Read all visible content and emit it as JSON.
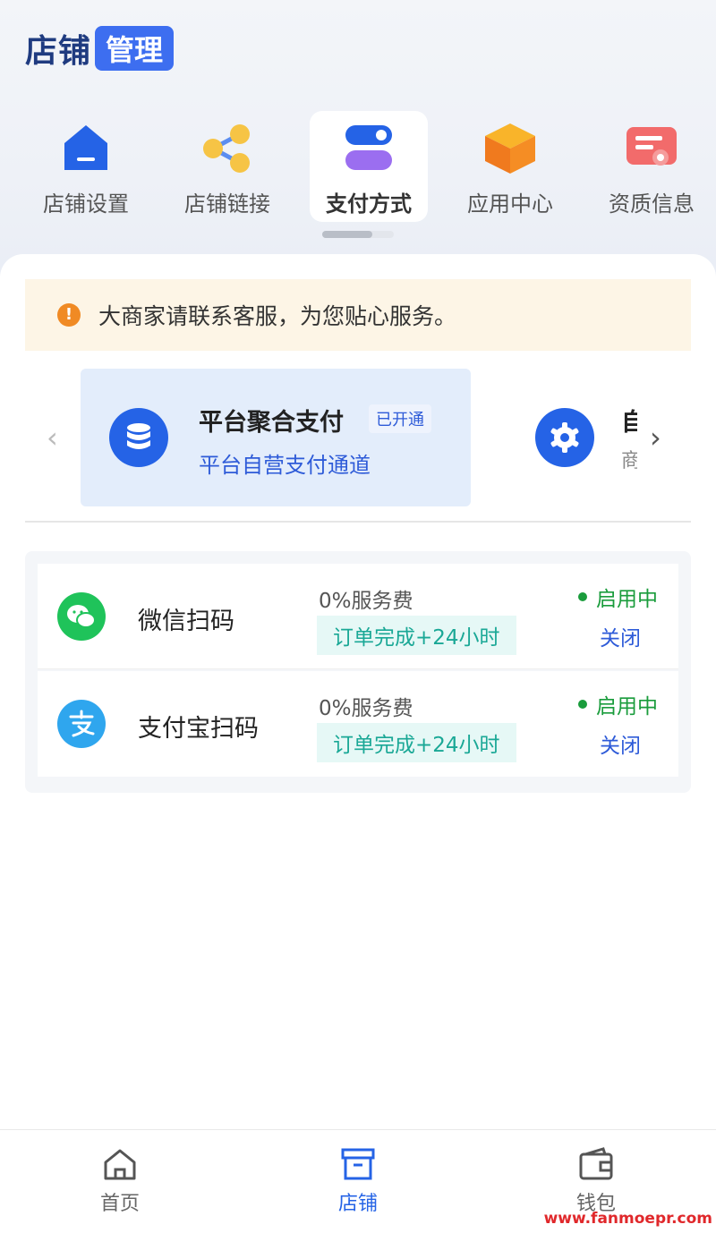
{
  "header": {
    "title": "店铺",
    "badge": "管理"
  },
  "tabs": [
    {
      "label": "店铺设置",
      "icon": "store-icon",
      "active": false
    },
    {
      "label": "店铺链接",
      "icon": "share-icon",
      "active": false
    },
    {
      "label": "支付方式",
      "icon": "toggle-icon",
      "active": true
    },
    {
      "label": "应用中心",
      "icon": "box-icon",
      "active": false
    },
    {
      "label": "资质信息",
      "icon": "certificate-icon",
      "active": false
    }
  ],
  "notice": {
    "icon": "!",
    "text": "大商家请联系客服，为您贴心服务。"
  },
  "carousel": {
    "prev_icon": "‹",
    "next_icon": "›",
    "cards": [
      {
        "name": "平台聚合支付",
        "badge": "已开通",
        "desc": "平台自营支付通道",
        "icon": "database-icon"
      },
      {
        "name": "自",
        "desc": "商",
        "icon": "gear-icon"
      }
    ]
  },
  "methods": [
    {
      "name": "微信扫码",
      "icon": "wechat-icon",
      "fee": "0%服务费",
      "tag": "订单完成+24小时",
      "status": "启用中",
      "action": "关闭"
    },
    {
      "name": "支付宝扫码",
      "icon": "alipay-icon",
      "fee": "0%服务费",
      "tag": "订单完成+24小时",
      "status": "启用中",
      "action": "关闭"
    }
  ],
  "bottom_nav": [
    {
      "label": "首页",
      "icon": "home-icon",
      "active": false
    },
    {
      "label": "店铺",
      "icon": "store-box-icon",
      "active": true
    },
    {
      "label": "钱包",
      "icon": "wallet-icon",
      "active": false
    }
  ],
  "watermark": "www.fanmoepr.com",
  "colors": {
    "primary": "#2563e6",
    "title": "#1f3b80",
    "success": "#1a9c3c",
    "notice_bg": "#fdf5e6"
  }
}
